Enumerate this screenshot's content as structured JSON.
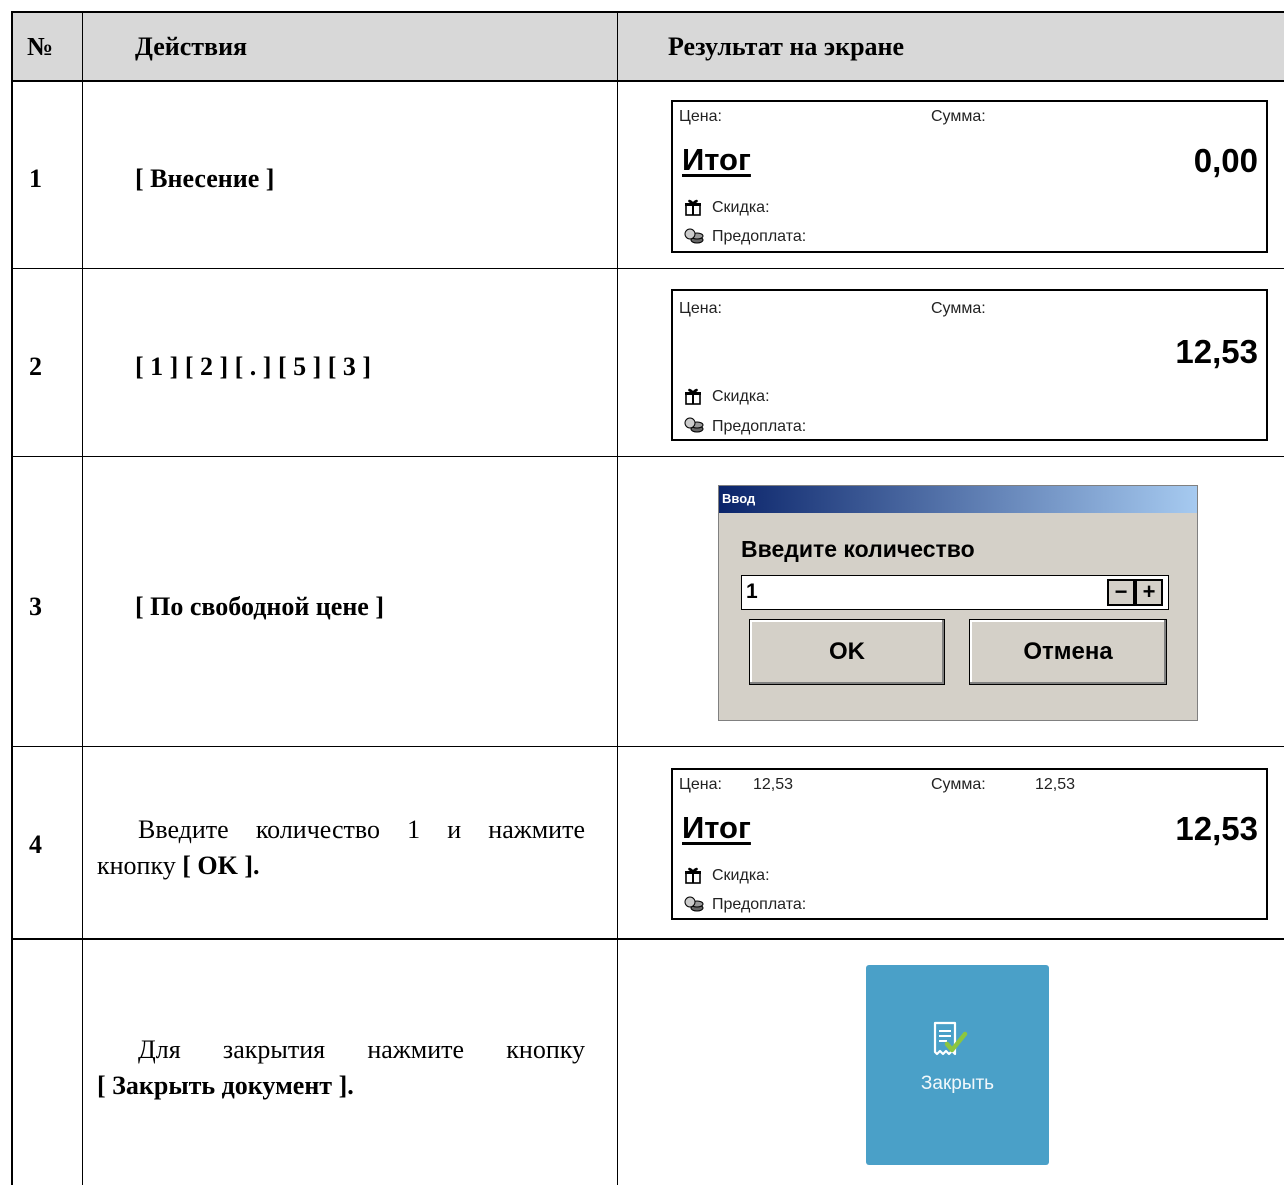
{
  "table": {
    "headers": {
      "number": "№",
      "actions": "Действия",
      "result": "Результат на экране"
    },
    "rows": [
      {
        "number": "1",
        "action": "[ Внесение ]"
      },
      {
        "number": "2",
        "action": "[ 1 ] [ 2 ] [ . ] [ 5 ] [ 3 ]"
      },
      {
        "number": "3",
        "action": "[ По свободной цене ]"
      },
      {
        "number": "4",
        "action_line1": "Введите количество 1 и нажмите",
        "action_line2_plain": "кнопку ",
        "action_line2_bold": "[ OK ]."
      },
      {
        "number": "",
        "action_line1": "Для закрытия нажмите кнопку",
        "action_line2_bold": "[ Закрыть документ ]."
      }
    ]
  },
  "screens": {
    "s1": {
      "price_label": "Цена:",
      "sum_label": "Сумма:",
      "title": "Итог",
      "total": "0,00",
      "discount_label": "Скидка:",
      "prepay_label": "Предоплата:"
    },
    "s2": {
      "price_label": "Цена:",
      "sum_label": "Сумма:",
      "total": "12,53",
      "discount_label": "Скидка:",
      "prepay_label": "Предоплата:"
    },
    "dialog": {
      "title": "Ввод",
      "prompt": "Введите количество",
      "value": "1",
      "minus": "−",
      "plus": "+",
      "ok": "OK",
      "cancel": "Отмена"
    },
    "s4": {
      "price_label": "Цена:",
      "price_value": "12,53",
      "sum_label": "Сумма:",
      "sum_value": "12,53",
      "title": "Итог",
      "total": "12,53",
      "discount_label": "Скидка:",
      "prepay_label": "Предоплата:"
    },
    "close_button": {
      "label": "Закрыть",
      "icon": "receipt-check-icon",
      "color": "#4aa0c8"
    }
  }
}
